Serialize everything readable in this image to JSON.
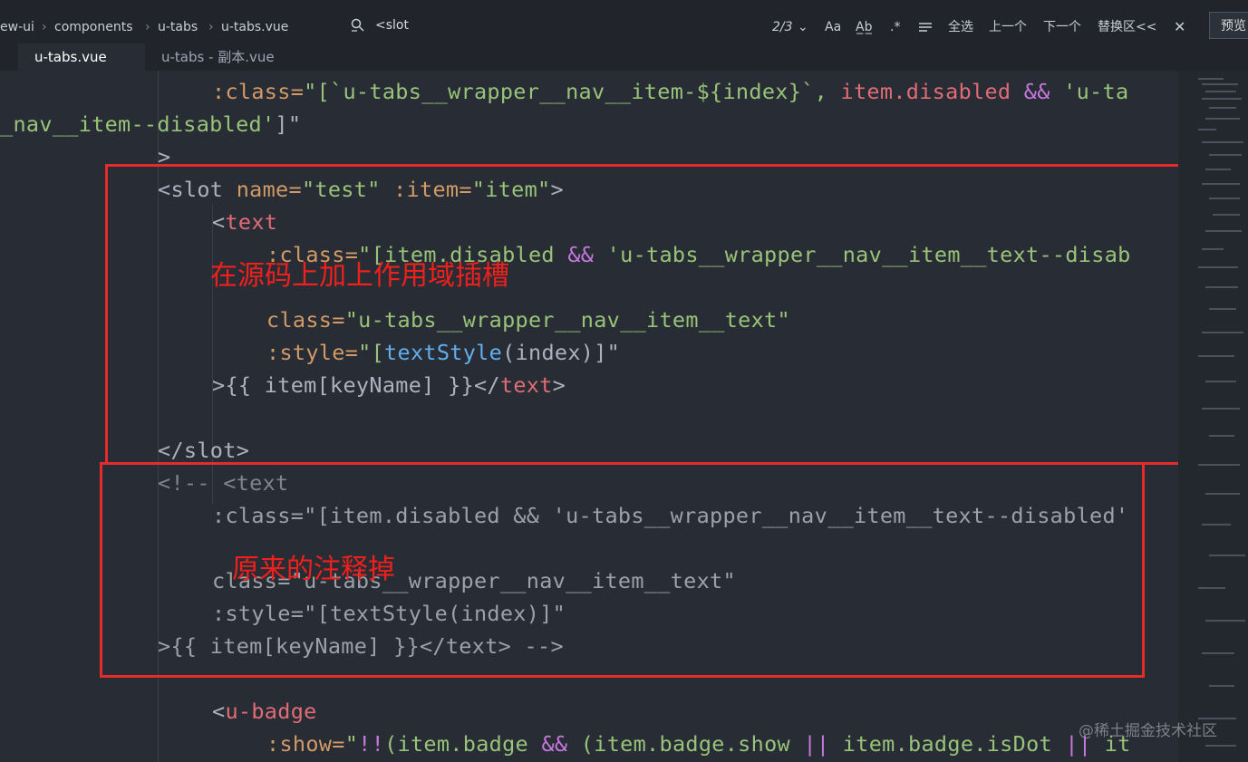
{
  "breadcrumb": {
    "items": [
      "ew-ui",
      "components",
      "u-tabs",
      "u-tabs.vue"
    ],
    "separator": "›"
  },
  "find": {
    "query": "<slot",
    "match_count": "2/3",
    "case_option": "Aa",
    "word_option": "A̲b̲",
    "regex_option": ".*",
    "select_all": "全选",
    "prev": "上一个",
    "next": "下一个",
    "replace": "替换区<<",
    "close": "✕",
    "preview": "预览"
  },
  "tabs": [
    {
      "label": "u-tabs.vue",
      "active": true
    },
    {
      "label": "u-tabs - 副本.vue",
      "active": false
    }
  ],
  "annotations": {
    "top_box_label": "在源码上加上作用域插槽",
    "bottom_box_label": "原来的注释掉",
    "color": "#e52b2b"
  },
  "code": {
    "l1_a": ":class=",
    "l1_b": "\"[`u-tabs__wrapper__nav__item-${index}`, ",
    "l1_c": "item.disabled",
    "l1_d": " && ",
    "l1_e": "'u-ta",
    "l2_a": "_nav__item--disabled'",
    "l2_b": "]\"",
    "l3": ">",
    "l4_a": "<slot ",
    "l4_b": "name=",
    "l4_c": "\"test\"",
    "l4_d": " :item=",
    "l4_e": "\"item\"",
    "l4_f": ">",
    "l5_a": "<",
    "l5_b": "text",
    "l6_a": ":class=",
    "l6_b": "\"[item.disabled",
    "l6_c": " && ",
    "l6_d": "'u-tabs__wrapper__nav__item__text--disab",
    "l8_a": "class=",
    "l8_b": "\"u-tabs__wrapper__nav__item__text\"",
    "l9_a": ":style=",
    "l9_b": "\"[",
    "l9_c": "textStyle",
    "l9_d": "(index)]\"",
    "l10_a": ">{{ item[keyName] }}</",
    "l10_b": "text",
    "l10_c": ">",
    "l12": "</slot>",
    "c1": "<!-- <text",
    "c2": ":class=\"[item.disabled && 'u-tabs__wrapper__nav__item__text--disabled'",
    "c4": "class=\"u-tabs__wrapper__nav__item__text\"",
    "c5": ":style=\"[textStyle(index)]\"",
    "c6": ">{{ item[keyName] }}</text> -->",
    "b1_a": "<",
    "b1_b": "u-badge",
    "b2_a": ":show=",
    "b2_b": "\"",
    "b2_c": "!!",
    "b2_d": "(item.badge ",
    "b2_e": "&&",
    "b2_f": " (item.badge.show ",
    "b2_g": "||",
    "b2_h": " item.badge.isDot ",
    "b2_i": "||",
    "b2_j": " it"
  },
  "watermark": "@稀土掘金技术社区"
}
